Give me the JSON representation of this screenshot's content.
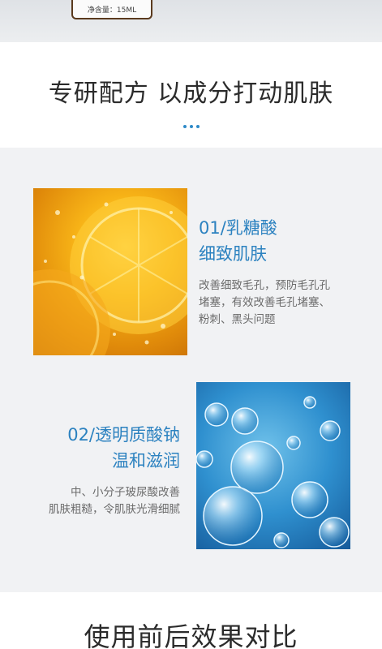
{
  "product": {
    "volume_label": "净含量：15ML"
  },
  "section1": {
    "title": "专研配方 以成分打动肌肤"
  },
  "ingredients": [
    {
      "heading_line1": "01/乳糖酸",
      "heading_line2": "细致肌肤",
      "desc_line1": "改善细致毛孔，预防毛孔孔",
      "desc_line2": "堵塞，有效改善毛孔堵塞、",
      "desc_line3": "粉刺、黑头问题",
      "image": "lemon-slices-photo"
    },
    {
      "heading_line1": "02/透明质酸钠",
      "heading_line2": "温和滋润",
      "desc_line1": "中、小分子玻尿酸改善",
      "desc_line2": "肌肤粗糙，令肌肤光滑细腻",
      "image": "water-bubbles-photo"
    }
  ],
  "section2": {
    "title": "使用前后效果对比"
  },
  "colors": {
    "accent_blue": "#2c82c0",
    "panel_gray": "#f1f2f4",
    "text_gray": "#6b6b6b"
  }
}
